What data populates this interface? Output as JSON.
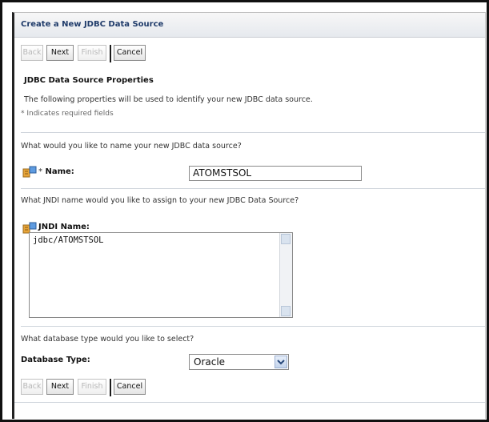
{
  "header": {
    "title": "Create a New JDBC Data Source"
  },
  "buttons_top": {
    "back": "Back",
    "next": "Next",
    "finish": "Finish",
    "cancel": "Cancel"
  },
  "buttons_bottom": {
    "back": "Back",
    "next": "Next",
    "finish": "Finish",
    "cancel": "Cancel"
  },
  "section": {
    "title": "JDBC Data Source Properties",
    "description": "The following properties will be used to identify your new JDBC data source.",
    "required_hint": "* Indicates required fields"
  },
  "name_field": {
    "question": "What would you like to name your new JDBC data source?",
    "required_marker": "*",
    "label": "Name:",
    "value": "ATOMSTSOL",
    "icon": "data-source-icon"
  },
  "jndi_field": {
    "question": "What JNDI name would you like to assign to your new JDBC Data Source?",
    "label": "JNDI Name:",
    "value": "jdbc/ATOMSTSOL",
    "icon": "data-source-icon"
  },
  "db_type_field": {
    "question": "What database type would you like to select?",
    "label": "Database Type:",
    "selected": "Oracle"
  }
}
